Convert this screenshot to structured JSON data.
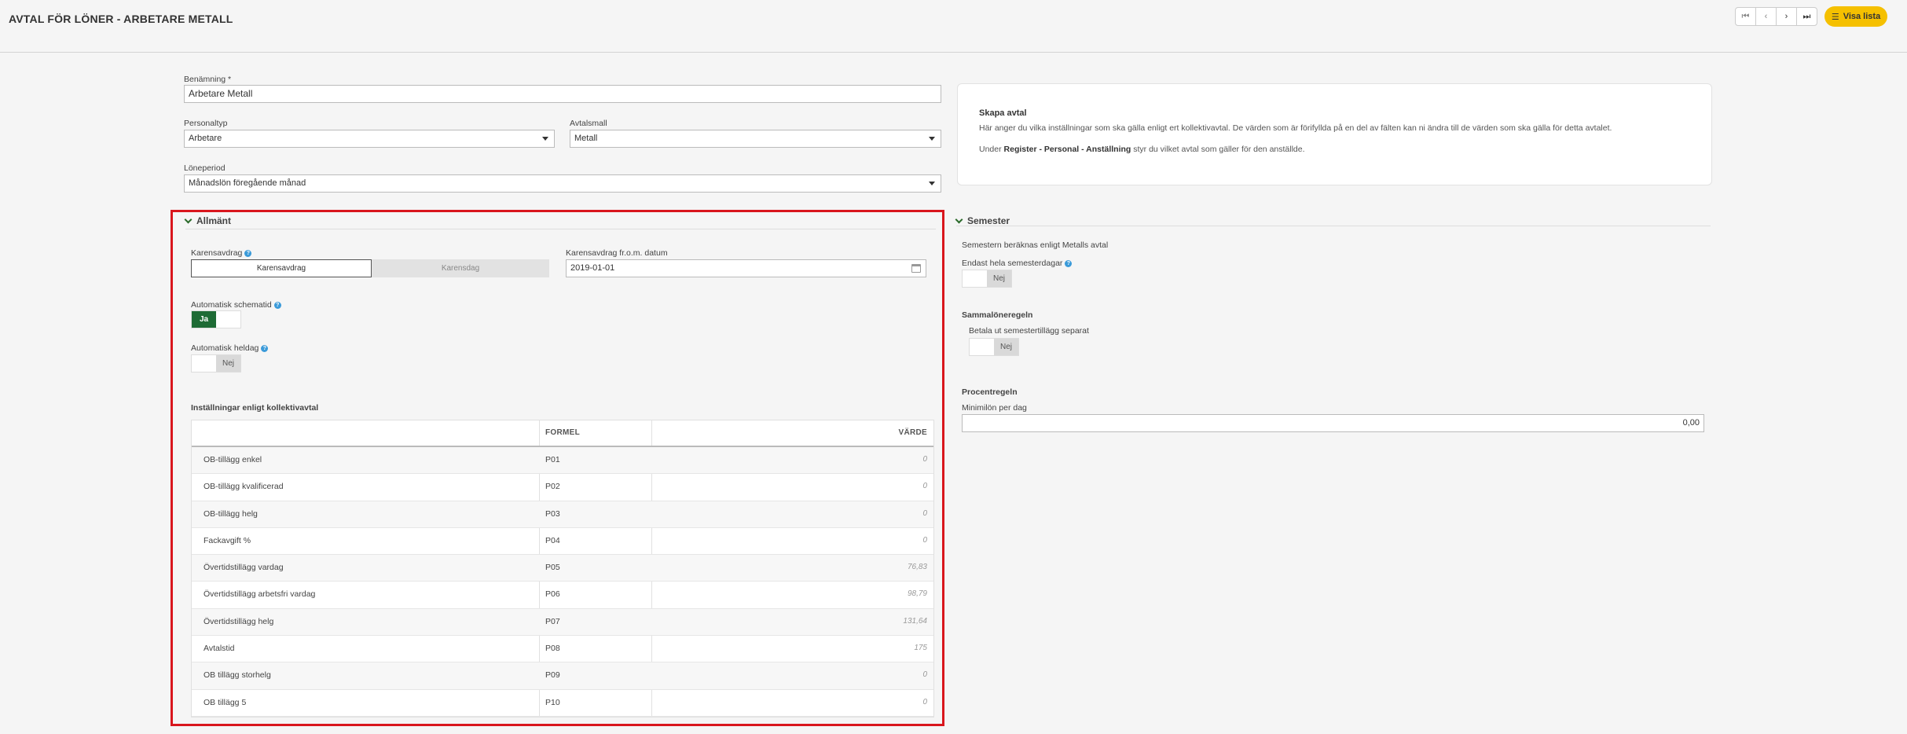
{
  "header": {
    "title": "AVTAL FÖR LÖNER - ARBETARE METALL",
    "nav": {
      "first": "⏮",
      "prev": "‹",
      "next": "›",
      "last": "⏭"
    },
    "visa_lista": "Visa lista",
    "visa_icon": "list-icon"
  },
  "form": {
    "benamning_label": "Benämning *",
    "benamning_value": "Arbetare Metall",
    "personaltyp_label": "Personaltyp",
    "personaltyp_value": "Arbetare",
    "avtalsmall_label": "Avtalsmall",
    "avtalsmall_value": "Metall",
    "loneperiod_label": "Löneperiod",
    "loneperiod_value": "Månadslön föregående månad"
  },
  "info": {
    "title": "Skapa avtal",
    "line1": "Här anger du vilka inställningar som ska gälla enligt ert kollektivavtal. De värden som är förifyllda på en del av fälten kan ni ändra till de värden som ska gälla för detta avtalet.",
    "line2_pre": "Under ",
    "line2_bold": "Register - Personal - Anställning",
    "line2_post": " styr du vilket avtal som gäller för den anställde."
  },
  "allmant": {
    "title": "Allmänt",
    "karensavdrag_label": "Karensavdrag",
    "karensavdrag_options": [
      "Karensavdrag",
      "Karensdag"
    ],
    "karens_datum_label": "Karensavdrag fr.o.m. datum",
    "karens_datum_value": "2019-01-01",
    "auto_schematid_label": "Automatisk schematid",
    "auto_schematid_value": "Ja",
    "auto_heldag_label": "Automatisk heldag",
    "auto_heldag_value": "Nej",
    "settings_title": "Inställningar enligt kollektivavtal",
    "table": {
      "col_formel": "FORMEL",
      "col_varde": "VÄRDE",
      "rows": [
        {
          "name": "OB-tillägg enkel",
          "formel": "P01",
          "value": "0"
        },
        {
          "name": "OB-tillägg kvalificerad",
          "formel": "P02",
          "value": "0"
        },
        {
          "name": "OB-tillägg helg",
          "formel": "P03",
          "value": "0"
        },
        {
          "name": "Fackavgift %",
          "formel": "P04",
          "value": "0"
        },
        {
          "name": "Övertidstillägg vardag",
          "formel": "P05",
          "value": "76,83"
        },
        {
          "name": "Övertidstillägg arbetsfri vardag",
          "formel": "P06",
          "value": "98,79"
        },
        {
          "name": "Övertidstillägg helg",
          "formel": "P07",
          "value": "131,64"
        },
        {
          "name": "Avtalstid",
          "formel": "P08",
          "value": "175"
        },
        {
          "name": "OB tillägg storhelg",
          "formel": "P09",
          "value": "0"
        },
        {
          "name": "OB tillägg 5",
          "formel": "P10",
          "value": "0"
        }
      ]
    }
  },
  "semester": {
    "title": "Semester",
    "info_text": "Semestern beräknas enligt Metalls avtal",
    "endast_label": "Endast hela semesterdagar",
    "endast_value": "Nej",
    "sammalon_title": "Sammalöneregeln",
    "betala_label": "Betala ut semestertillägg separat",
    "betala_value": "Nej",
    "procent_title": "Procentregeln",
    "minimilon_label": "Minimilön per dag",
    "minimilon_value": "0,00"
  }
}
